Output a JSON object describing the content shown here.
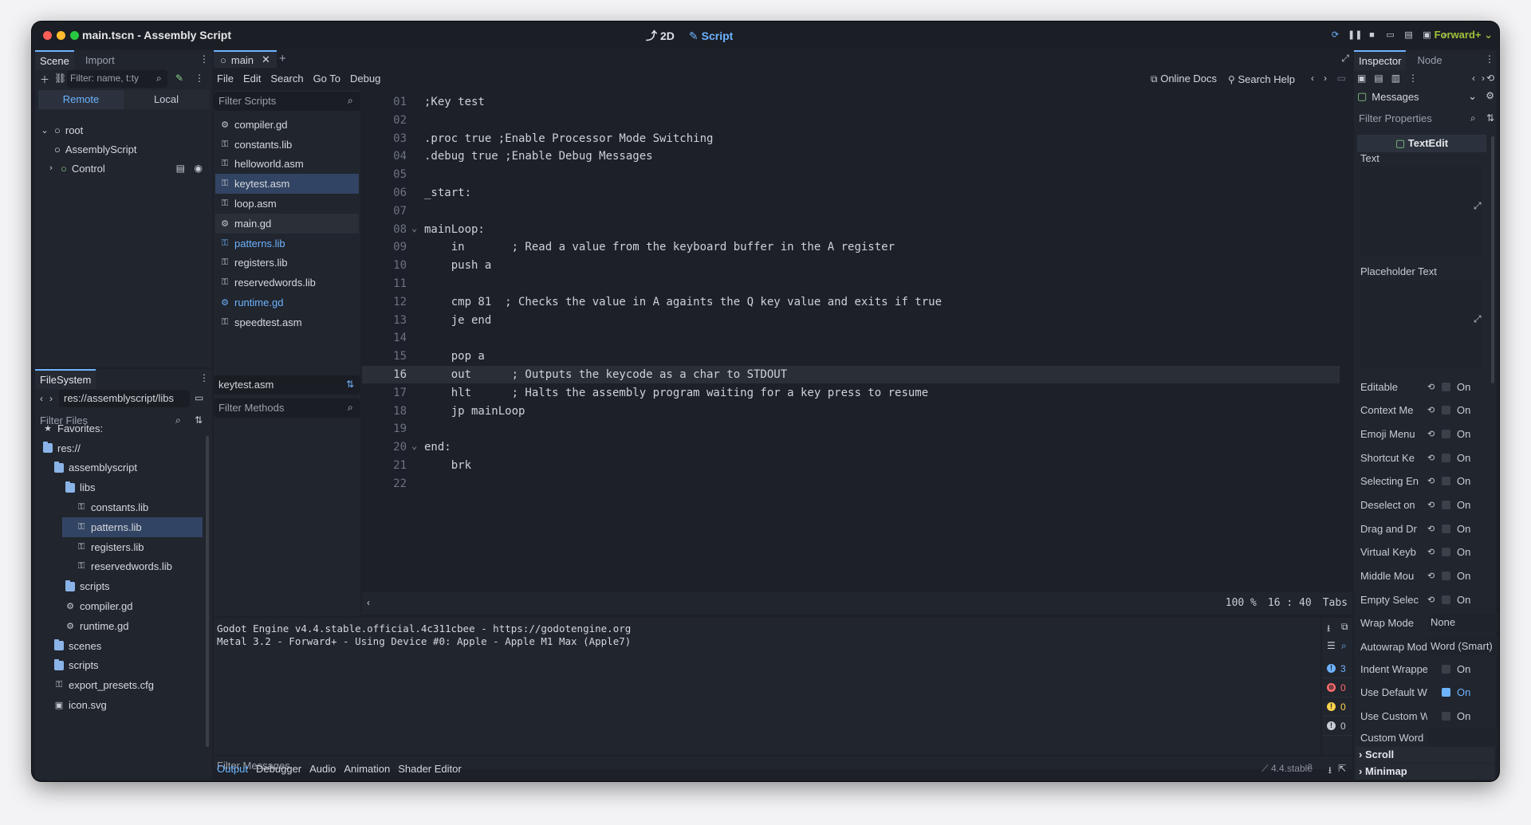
{
  "window": {
    "title": "main.tscn - Assembly Script",
    "workspaces": [
      {
        "label": "2D",
        "icon": "2d-icon",
        "active": false
      },
      {
        "label": "Script",
        "icon": "script-icon",
        "active": true
      }
    ],
    "renderer": "Forward+"
  },
  "scene_dock": {
    "tabs": [
      "Scene",
      "Import"
    ],
    "filter_placeholder": "Filter: name, t:ty",
    "toggle": [
      "Remote",
      "Local"
    ],
    "tree": [
      {
        "label": "root",
        "indent": 0,
        "icon": "circle-icon"
      },
      {
        "label": "AssemblyScript",
        "indent": 1,
        "icon": "node-circle-icon"
      },
      {
        "label": "Control",
        "indent": 1,
        "icon": "control-node-icon"
      }
    ]
  },
  "filesystem": {
    "tab": "FileSystem",
    "path": "res://assemblyscript/libs",
    "filter_placeholder": "Filter Files",
    "items": [
      {
        "label": "Favorites:",
        "indent": 0,
        "kind": "star"
      },
      {
        "label": "res://",
        "indent": 0,
        "kind": "folder"
      },
      {
        "label": "assemblyscript",
        "indent": 1,
        "kind": "folder"
      },
      {
        "label": "libs",
        "indent": 2,
        "kind": "folder"
      },
      {
        "label": "constants.lib",
        "indent": 3,
        "kind": "file"
      },
      {
        "label": "patterns.lib",
        "indent": 3,
        "kind": "file",
        "selected": true
      },
      {
        "label": "registers.lib",
        "indent": 3,
        "kind": "file"
      },
      {
        "label": "reservedwords.lib",
        "indent": 3,
        "kind": "file"
      },
      {
        "label": "scripts",
        "indent": 2,
        "kind": "folder"
      },
      {
        "label": "compiler.gd",
        "indent": 2,
        "kind": "gear"
      },
      {
        "label": "runtime.gd",
        "indent": 2,
        "kind": "gear"
      },
      {
        "label": "scenes",
        "indent": 1,
        "kind": "folder"
      },
      {
        "label": "scripts",
        "indent": 1,
        "kind": "folder"
      },
      {
        "label": "export_presets.cfg",
        "indent": 1,
        "kind": "file"
      },
      {
        "label": "icon.svg",
        "indent": 1,
        "kind": "image"
      }
    ]
  },
  "editor_tabs": {
    "open": "main",
    "add": "+"
  },
  "script_menu": [
    "File",
    "Edit",
    "Search",
    "Go To",
    "Debug"
  ],
  "script_toolbar": {
    "online_docs": "Online Docs",
    "search_help": "Search Help"
  },
  "script_list": {
    "filter_placeholder": "Filter Scripts",
    "items": [
      {
        "label": "compiler.gd",
        "kind": "gear"
      },
      {
        "label": "constants.lib",
        "kind": "file"
      },
      {
        "label": "helloworld.asm",
        "kind": "file"
      },
      {
        "label": "keytest.asm",
        "kind": "file",
        "selected": true
      },
      {
        "label": "loop.asm",
        "kind": "file"
      },
      {
        "label": "main.gd",
        "kind": "gear",
        "hover": true
      },
      {
        "label": "patterns.lib",
        "kind": "file",
        "blue": true
      },
      {
        "label": "registers.lib",
        "kind": "file"
      },
      {
        "label": "reservedwords.lib",
        "kind": "file"
      },
      {
        "label": "runtime.gd",
        "kind": "gear",
        "blue": true
      },
      {
        "label": "speedtest.asm",
        "kind": "file"
      }
    ],
    "current_file": "keytest.asm",
    "methods_placeholder": "Filter Methods"
  },
  "code": {
    "lines": [
      {
        "n": "01",
        "text": ";Key test",
        "fold": false
      },
      {
        "n": "02",
        "text": "",
        "fold": false
      },
      {
        "n": "03",
        "text": ".proc true ;Enable Processor Mode Switching",
        "fold": false
      },
      {
        "n": "04",
        "text": ".debug true ;Enable Debug Messages",
        "fold": false
      },
      {
        "n": "05",
        "text": "",
        "fold": false
      },
      {
        "n": "06",
        "text": "_start:",
        "fold": false
      },
      {
        "n": "07",
        "text": "",
        "fold": false
      },
      {
        "n": "08",
        "text": "mainLoop:",
        "fold": true
      },
      {
        "n": "09",
        "text": "    in       ; Read a value from the keyboard buffer in the A register",
        "fold": false
      },
      {
        "n": "10",
        "text": "    push a",
        "fold": false
      },
      {
        "n": "11",
        "text": "",
        "fold": false
      },
      {
        "n": "12",
        "text": "    cmp 81  ; Checks the value in A againts the Q key value and exits if true",
        "fold": false
      },
      {
        "n": "13",
        "text": "    je end",
        "fold": false
      },
      {
        "n": "14",
        "text": "",
        "fold": false
      },
      {
        "n": "15",
        "text": "    pop a",
        "fold": false
      },
      {
        "n": "16",
        "text": "    out      ; Outputs the keycode as a char to STDOUT",
        "fold": false,
        "current": true
      },
      {
        "n": "17",
        "text": "    hlt      ; Halts the assembly program waiting for a key press to resume",
        "fold": false
      },
      {
        "n": "18",
        "text": "    jp mainLoop",
        "fold": false
      },
      {
        "n": "19",
        "text": "",
        "fold": false
      },
      {
        "n": "20",
        "text": "end:",
        "fold": true
      },
      {
        "n": "21",
        "text": "    brk",
        "fold": false
      },
      {
        "n": "22",
        "text": "",
        "fold": false
      }
    ],
    "status": {
      "zoom": "100 %",
      "line": "16",
      "col": "40",
      "indent": "Tabs"
    }
  },
  "output": {
    "lines": [
      "Godot Engine v4.4.stable.official.4c311cbee - https://godotengine.org",
      "Metal 3.2 - Forward+ - Using Device #0: Apple - Apple M1 Max (Apple7)"
    ],
    "filter_placeholder": "Filter Messages",
    "counters": [
      {
        "icon": "message-icon",
        "value": "3",
        "color": "#6db3ff"
      },
      {
        "icon": "error-icon",
        "value": "0",
        "color": "#ff6b6b"
      },
      {
        "icon": "warning-icon",
        "value": "0",
        "color": "#ffd34d"
      },
      {
        "icon": "info-icon",
        "value": "0",
        "color": "#c8ccd4"
      }
    ],
    "bottom_tabs": [
      "Output",
      "Debugger",
      "Audio",
      "Animation",
      "Shader Editor"
    ],
    "version": "4.4.stable"
  },
  "inspector": {
    "tabs": [
      "Inspector",
      "Node"
    ],
    "object": "Messages",
    "filter_placeholder": "Filter Properties",
    "class_header": "TextEdit",
    "text_label": "Text",
    "placeholder_label": "Placeholder Text",
    "bool_props": [
      {
        "label": "Editable",
        "value": "On",
        "checked": false
      },
      {
        "label": "Context Me",
        "value": "On",
        "checked": false
      },
      {
        "label": "Emoji Menu",
        "value": "On",
        "checked": false
      },
      {
        "label": "Shortcut Ke",
        "value": "On",
        "checked": false
      },
      {
        "label": "Selecting En",
        "value": "On",
        "checked": false
      },
      {
        "label": "Deselect on",
        "value": "On",
        "checked": false
      },
      {
        "label": "Drag and Dr",
        "value": "On",
        "checked": false
      },
      {
        "label": "Virtual Keyb",
        "value": "On",
        "checked": false
      },
      {
        "label": "Middle Mou",
        "value": "On",
        "checked": false
      },
      {
        "label": "Empty Selec",
        "value": "On",
        "checked": false
      }
    ],
    "wrap_mode": {
      "label": "Wrap Mode",
      "value": "None"
    },
    "autowrap": {
      "label": "Autowrap Mod",
      "value": "Word (Smart)"
    },
    "bool_props2": [
      {
        "label": "Indent Wrappe",
        "value": "On",
        "checked": false
      },
      {
        "label": "Use Default W",
        "value": "On",
        "checked": true
      },
      {
        "label": "Use Custom W",
        "value": "On",
        "checked": false
      }
    ],
    "custom_word": "Custom Word",
    "sections": [
      "Scroll",
      "Minimap"
    ]
  },
  "colors": {
    "accent": "#6db3ff",
    "renderer": "#9fc23a",
    "selection": "#324463"
  }
}
